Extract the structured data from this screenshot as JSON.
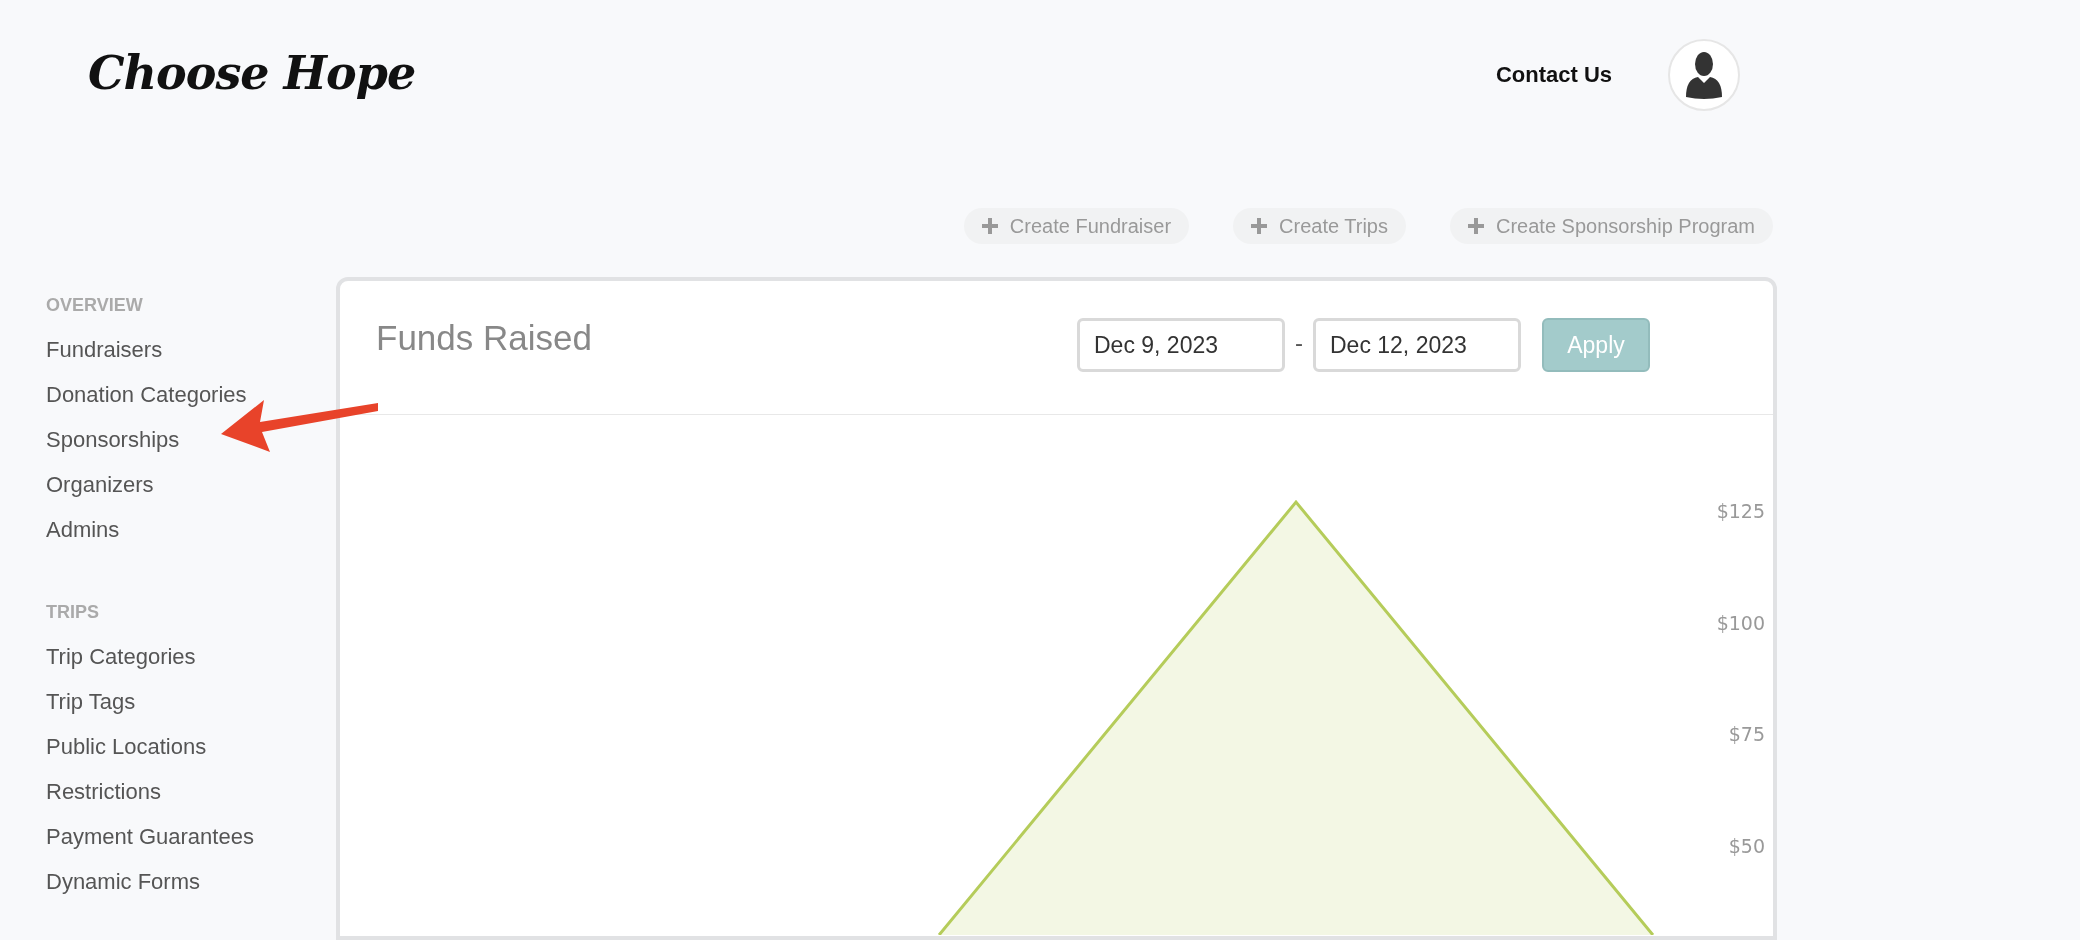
{
  "header": {
    "logo": "Choose Hope",
    "contact_link": "Contact Us"
  },
  "actions": [
    {
      "label": "Create Fundraiser"
    },
    {
      "label": "Create Trips"
    },
    {
      "label": "Create Sponsorship Program"
    }
  ],
  "sidebar": {
    "sections": [
      {
        "heading": "OVERVIEW",
        "items": [
          "Fundraisers",
          "Donation Categories",
          "Sponsorships",
          "Organizers",
          "Admins"
        ]
      },
      {
        "heading": "TRIPS",
        "items": [
          "Trip Categories",
          "Trip Tags",
          "Public Locations",
          "Restrictions",
          "Payment Guarantees",
          "Dynamic Forms"
        ]
      }
    ]
  },
  "funds_card": {
    "title": "Funds Raised",
    "start_date": "Dec 9, 2023",
    "separator": "-",
    "end_date": "Dec 12, 2023",
    "apply_button": "Apply",
    "axis_labels": [
      "$125",
      "$100",
      "$75",
      "$50"
    ]
  }
}
